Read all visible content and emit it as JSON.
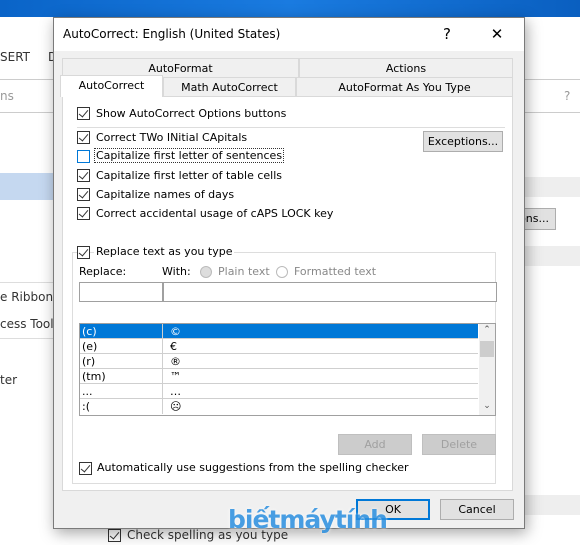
{
  "background": {
    "ribbon_tab": "SERT",
    "ribbon_tab2": "D",
    "search_hint": "ns",
    "help": "?",
    "items": [
      "e Ribbon",
      "cess Toolba",
      "ter"
    ],
    "button": "ons...",
    "check_spelling": "Check spelling as you type"
  },
  "dialog": {
    "title": "AutoCorrect: English (United States)",
    "help_label": "?",
    "close_label": "✕",
    "tabs_top": [
      "AutoFormat",
      "Actions"
    ],
    "tabs_bottom": [
      "AutoCorrect",
      "Math AutoCorrect",
      "AutoFormat As You Type"
    ],
    "selected_tab": "AutoCorrect",
    "show_options": {
      "label": "Show AutoCorrect Options buttons",
      "checked": true
    },
    "options": [
      {
        "label": "Correct TWo INitial CApitals",
        "checked": true
      },
      {
        "label": "Capitalize first letter of sentences",
        "checked": false
      },
      {
        "label": "Capitalize first letter of table cells",
        "checked": true
      },
      {
        "label": "Capitalize names of days",
        "checked": true
      },
      {
        "label": "Correct accidental usage of cAPS LOCK key",
        "checked": true
      }
    ],
    "exceptions_label": "Exceptions...",
    "replace_as_type": {
      "label": "Replace text as you type",
      "checked": true
    },
    "replace_label": "Replace:",
    "with_label": "With:",
    "plain_text": "Plain text",
    "formatted_text": "Formatted text",
    "replace_value": "",
    "with_value": "",
    "entries": [
      {
        "replace": "(c)",
        "with": "©"
      },
      {
        "replace": "(e)",
        "with": "€"
      },
      {
        "replace": "(r)",
        "with": "®"
      },
      {
        "replace": "(tm)",
        "with": "™"
      },
      {
        "replace": "...",
        "with": "…"
      },
      {
        "replace": ":(",
        "with": "☹"
      }
    ],
    "add_label": "Add",
    "delete_label": "Delete",
    "spelling_suggestions": {
      "label": "Automatically use suggestions from the spelling checker",
      "checked": true
    },
    "ok_label": "OK",
    "cancel_label": "Cancel"
  },
  "watermark": "biếtmáytính",
  "colors": {
    "accent": "#0078d7",
    "titlebar": "#0a64c8"
  }
}
